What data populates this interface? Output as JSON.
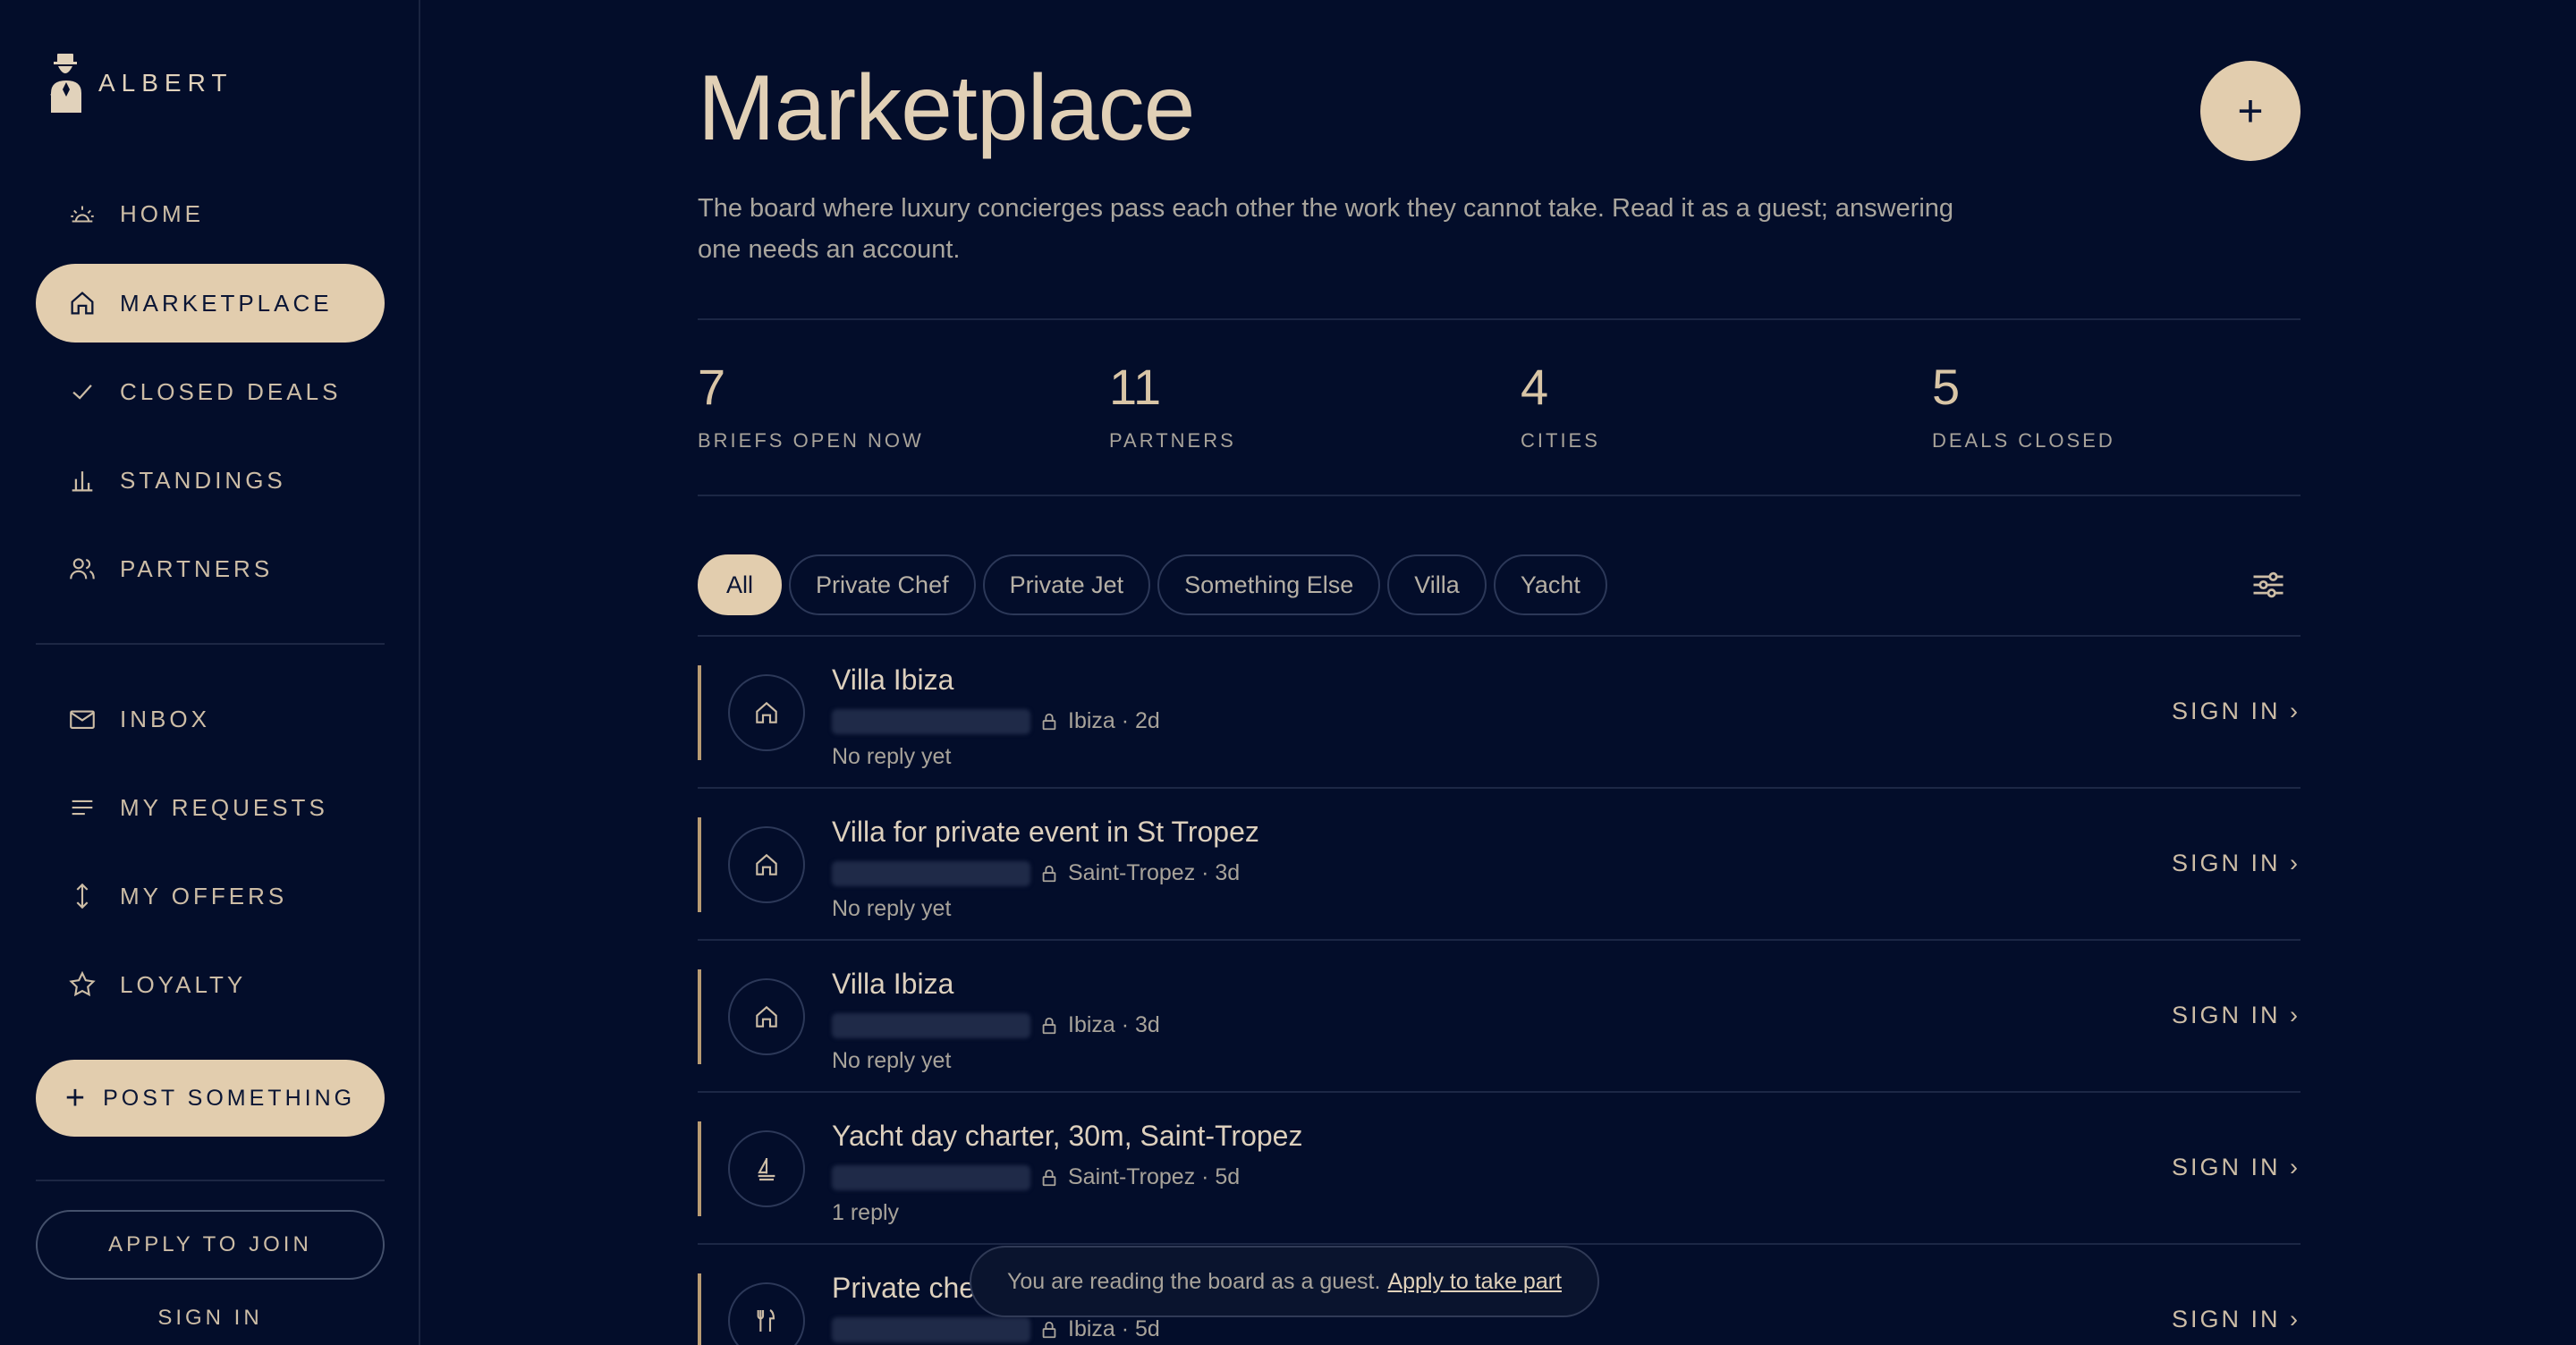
{
  "brand": {
    "name": "ALBERT"
  },
  "sidebar": {
    "nav": [
      {
        "label": "HOME",
        "icon": "sun-icon"
      },
      {
        "label": "MARKETPLACE",
        "icon": "home-icon",
        "active": true
      },
      {
        "label": "CLOSED DEALS",
        "icon": "check-icon"
      },
      {
        "label": "STANDINGS",
        "icon": "bar-chart-icon"
      },
      {
        "label": "PARTNERS",
        "icon": "users-icon"
      }
    ],
    "nav2": [
      {
        "label": "INBOX",
        "icon": "mail-icon"
      },
      {
        "label": "MY REQUESTS",
        "icon": "list-icon"
      },
      {
        "label": "MY OFFERS",
        "icon": "arrows-vertical-icon"
      },
      {
        "label": "LOYALTY",
        "icon": "star-icon"
      }
    ],
    "post_label": "POST SOMETHING",
    "apply_label": "APPLY TO JOIN",
    "signin_label": "SIGN IN"
  },
  "main": {
    "title": "Marketplace",
    "add_label": "+",
    "subtitle": "The board where luxury concierges pass each other the work they cannot take. Read it as a guest; answering one needs an account.",
    "stats": [
      {
        "value": "7",
        "label": "BRIEFS OPEN NOW"
      },
      {
        "value": "11",
        "label": "PARTNERS"
      },
      {
        "value": "4",
        "label": "CITIES"
      },
      {
        "value": "5",
        "label": "DEALS CLOSED"
      }
    ],
    "filters": [
      "All",
      "Private Chef",
      "Private Jet",
      "Something Else",
      "Villa",
      "Yacht"
    ],
    "active_filter": "All",
    "listings": [
      {
        "title": "Villa Ibiza",
        "location": "Ibiza · 2d",
        "replies": "No reply yet",
        "icon": "home-icon",
        "cta": "SIGN IN ›"
      },
      {
        "title": "Villa for private event in St Tropez",
        "location": "Saint-Tropez · 3d",
        "replies": "No reply yet",
        "icon": "home-icon",
        "cta": "SIGN IN ›"
      },
      {
        "title": "Villa Ibiza",
        "location": "Ibiza · 3d",
        "replies": "No reply yet",
        "icon": "home-icon",
        "cta": "SIGN IN ›"
      },
      {
        "title": "Yacht day charter, 30m, Saint-Tropez",
        "location": "Saint-Tropez · 5d",
        "replies": "1 reply",
        "icon": "sailboat-icon",
        "cta": "SIGN IN ›"
      },
      {
        "title": "Private che",
        "location": "Ibiza · 5d",
        "replies": "",
        "icon": "fork-knife-icon",
        "cta": "SIGN IN ›"
      }
    ]
  },
  "toast": {
    "text": "You are reading the board as a guest.",
    "link": "Apply to take part"
  },
  "colors": {
    "background": "#030d2a",
    "accent": "#e2cdae",
    "text": "#d8c7ae",
    "muted": "#a8a39a"
  }
}
